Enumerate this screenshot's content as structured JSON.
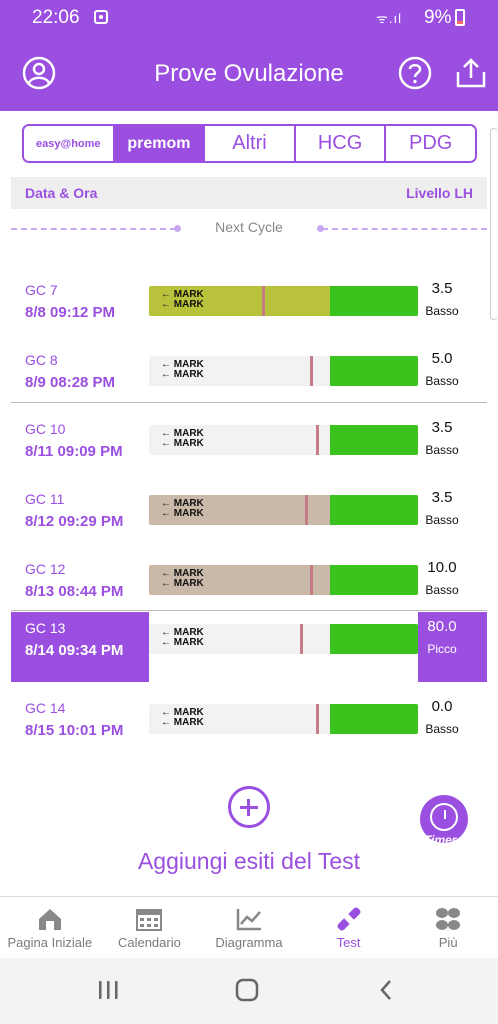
{
  "status_bar": {
    "time": "22:06",
    "signal": "ᯤ.ıl",
    "battery": "9%"
  },
  "app_bar": {
    "title": "Prove Ovulazione"
  },
  "brand_tabs": [
    {
      "label": "easy@home",
      "active": false
    },
    {
      "label": "premom",
      "active": true
    },
    {
      "label": "Altri",
      "active": false
    },
    {
      "label": "HCG",
      "active": false
    },
    {
      "label": "PDG",
      "active": false
    }
  ],
  "table_header": {
    "left": "Data & Ora",
    "right": "Livello LH"
  },
  "cycle_label": "Next Cycle",
  "rows": [
    {
      "name": "GC 7",
      "date": "8/8  09:12 PM",
      "level": "3.5",
      "category": "Basso",
      "strip_style": "yellow",
      "band": 0.42
    },
    {
      "name": "GC 8",
      "date": "8/9  08:28 PM",
      "level": "5.0",
      "category": "Basso",
      "strip_style": "white",
      "band": 0.6
    },
    {
      "name": "GC 10",
      "date": "8/11  09:09 PM",
      "level": "3.5",
      "category": "Basso",
      "strip_style": "white",
      "band": 0.62
    },
    {
      "name": "GC 11",
      "date": "8/12  09:29 PM",
      "level": "3.5",
      "category": "Basso",
      "strip_style": "tan",
      "band": 0.58
    },
    {
      "name": "GC 12",
      "date": "8/13  08:44 PM",
      "level": "10.0",
      "category": "Basso",
      "strip_style": "tan",
      "band": 0.6
    },
    {
      "name": "GC 13",
      "date": "8/14  09:34 PM",
      "level": "80.0",
      "category": "Picco",
      "strip_style": "white",
      "band": 0.56,
      "selected": true
    },
    {
      "name": "GC 14",
      "date": "8/15  10:01 PM",
      "level": "0.0",
      "category": "Basso",
      "strip_style": "white",
      "band": 0.62
    }
  ],
  "strip_mark_text": "← MARK",
  "add_results": "Aggiungi esiti del Test",
  "timer_label": "Timer",
  "bottom_nav": [
    {
      "label": "Pagina Iniziale",
      "icon": "home-icon",
      "active": false
    },
    {
      "label": "Calendario",
      "icon": "calendar-icon",
      "active": false
    },
    {
      "label": "Diagramma",
      "icon": "chart-icon",
      "active": false
    },
    {
      "label": "Test",
      "icon": "test-strip-icon",
      "active": true
    },
    {
      "label": "Più",
      "icon": "more-icon",
      "active": false
    }
  ],
  "colors": {
    "accent": "#9b4fe0",
    "strip_green": "#3bc31d",
    "band": "#c77b88"
  }
}
